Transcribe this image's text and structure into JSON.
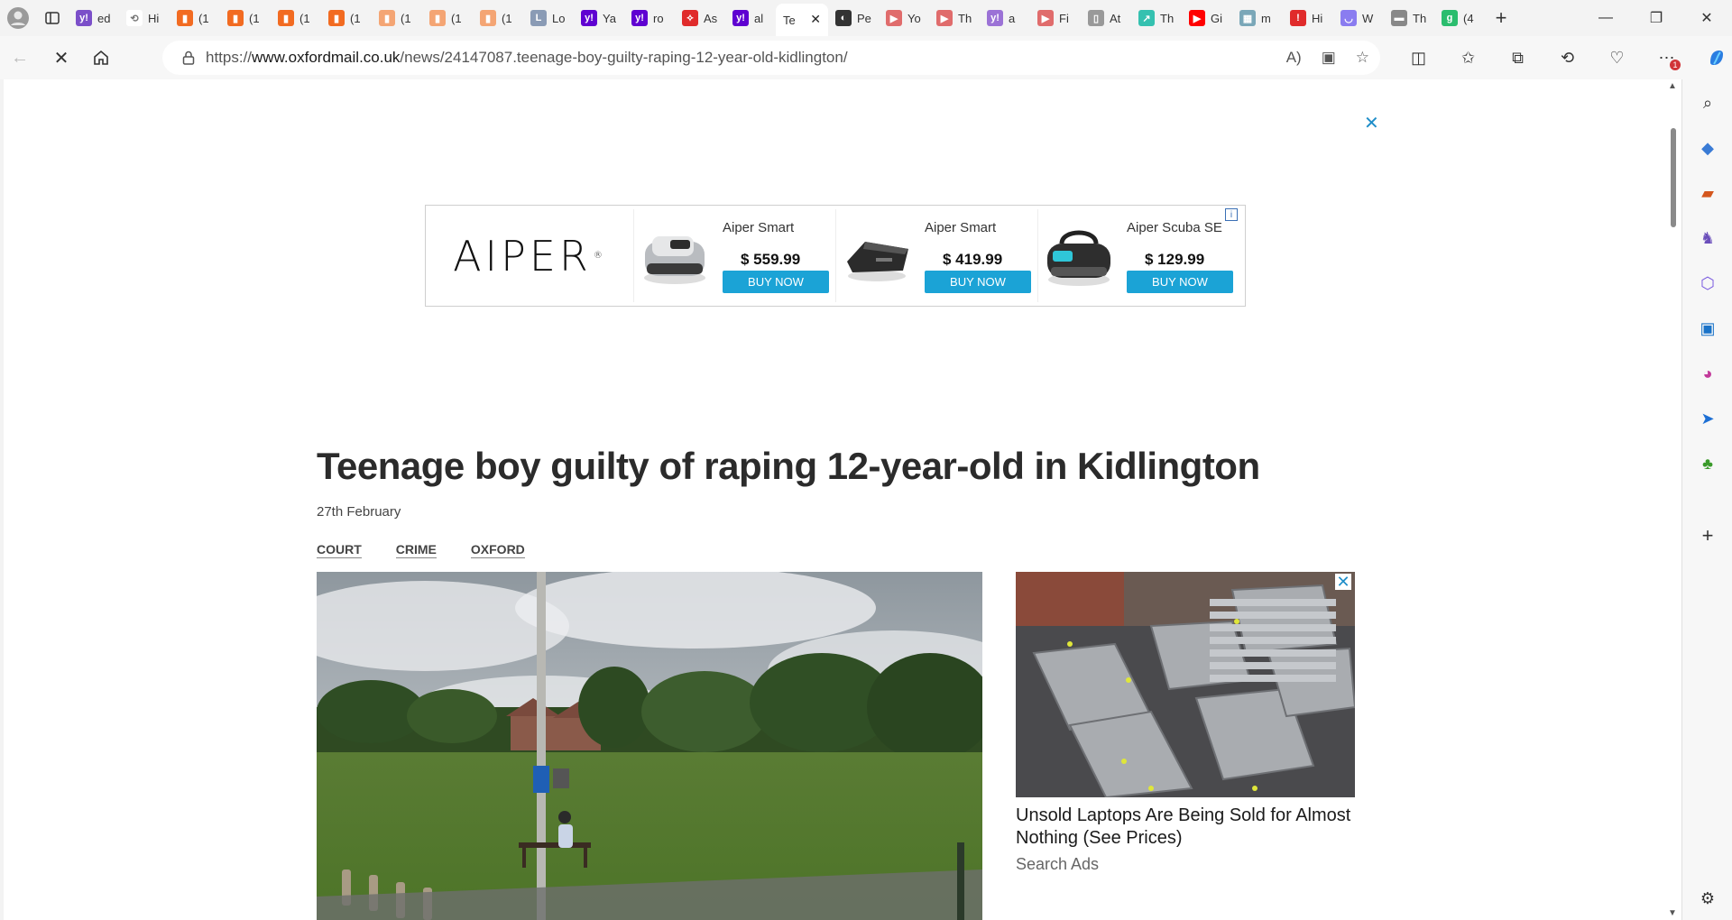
{
  "browser": {
    "tabs": [
      {
        "label": "ed",
        "color": "#7b4fc9",
        "glyph": "y!"
      },
      {
        "label": "Hi",
        "color": "#ffffff",
        "glyph": "⟲"
      },
      {
        "label": "(1",
        "color": "#f26b21",
        "glyph": "▮"
      },
      {
        "label": "(1",
        "color": "#f26b21",
        "glyph": "▮"
      },
      {
        "label": "(1",
        "color": "#f26b21",
        "glyph": "▮"
      },
      {
        "label": "(1",
        "color": "#f26b21",
        "glyph": "▮"
      },
      {
        "label": "(1",
        "color": "#f4a574",
        "glyph": "▮"
      },
      {
        "label": "(1",
        "color": "#f4a574",
        "glyph": "▮"
      },
      {
        "label": "(1",
        "color": "#f4a574",
        "glyph": "▮"
      },
      {
        "label": "Lo",
        "color": "#8a9bb5",
        "glyph": "L"
      },
      {
        "label": "Ya",
        "color": "#5f01d1",
        "glyph": "y!"
      },
      {
        "label": "ro",
        "color": "#5f01d1",
        "glyph": "y!"
      },
      {
        "label": "As",
        "color": "#e02b2b",
        "glyph": "⟡"
      },
      {
        "label": "al",
        "color": "#5f01d1",
        "glyph": "y!"
      }
    ],
    "active_tab": {
      "label": "Te"
    },
    "tabs_after": [
      {
        "label": "Pe",
        "color": "#333333",
        "glyph": "◐"
      },
      {
        "label": "Yo",
        "color": "#e06c6c",
        "glyph": "▶"
      },
      {
        "label": "Th",
        "color": "#e06c6c",
        "glyph": "▶"
      },
      {
        "label": "a",
        "color": "#9b72d6",
        "glyph": "y!"
      },
      {
        "label": "Fi",
        "color": "#e06c6c",
        "glyph": "▶"
      },
      {
        "label": "At",
        "color": "#999999",
        "glyph": "▯"
      },
      {
        "label": "Th",
        "color": "#35c1b0",
        "glyph": "↗"
      },
      {
        "label": "Gi",
        "color": "#ff0000",
        "glyph": "▶"
      },
      {
        "label": "m",
        "color": "#7aa7b8",
        "glyph": "▦"
      },
      {
        "label": "Hi",
        "color": "#e02b2b",
        "glyph": "!"
      },
      {
        "label": "W",
        "color": "#8a7cf0",
        "glyph": "◡"
      },
      {
        "label": "Th",
        "color": "#888888",
        "glyph": "▬"
      },
      {
        "label": "(4",
        "color": "#2bbd6e",
        "glyph": "g"
      }
    ],
    "url_prefix": "https://",
    "url_host": "www.oxfordmail.co.uk",
    "url_path": "/news/24147087.teenage-boy-guilty-raping-12-year-old-kidlington/",
    "badge_count": "1"
  },
  "ad_banner": {
    "brand": "AIPER",
    "items": [
      {
        "name": "Aiper Smart",
        "price": "$ 559.99",
        "cta": "BUY NOW"
      },
      {
        "name": "Aiper Smart",
        "price": "$ 419.99",
        "cta": "BUY NOW"
      },
      {
        "name": "Aiper Scuba SE",
        "price": "$ 129.99",
        "cta": "BUY NOW"
      }
    ]
  },
  "article": {
    "headline": "Teenage boy guilty of raping 12-year-old in Kidlington",
    "date": "27th February",
    "tags": [
      "COURT",
      "CRIME",
      "OXFORD"
    ]
  },
  "side_ad": {
    "title": "Unsold Laptops Are Being Sold for Almost Nothing (See Prices)",
    "source": "Search Ads"
  }
}
